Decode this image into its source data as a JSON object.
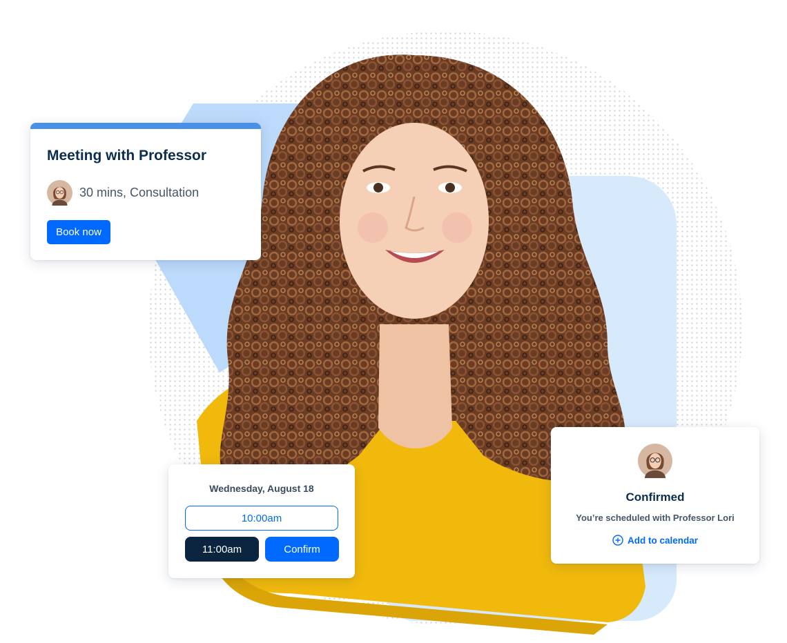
{
  "meeting_card": {
    "title": "Meeting with Professor",
    "details": "30 mins, Consultation",
    "book_label": "Book now",
    "accent": "#4a90e8"
  },
  "time_card": {
    "date": "Wednesday, August 18",
    "slots": [
      "10:00am",
      "11:00am"
    ],
    "confirm_label": "Confirm"
  },
  "confirm_card": {
    "title": "Confirmed",
    "message": "You’re scheduled with Professor Lori",
    "add_calendar_label": "Add to calendar",
    "add_icon": "plus-circle-icon"
  },
  "colors": {
    "primary": "#0069ff",
    "navy": "#0b2541",
    "shirt": "#f1b90c",
    "hair": "#6e4027"
  }
}
